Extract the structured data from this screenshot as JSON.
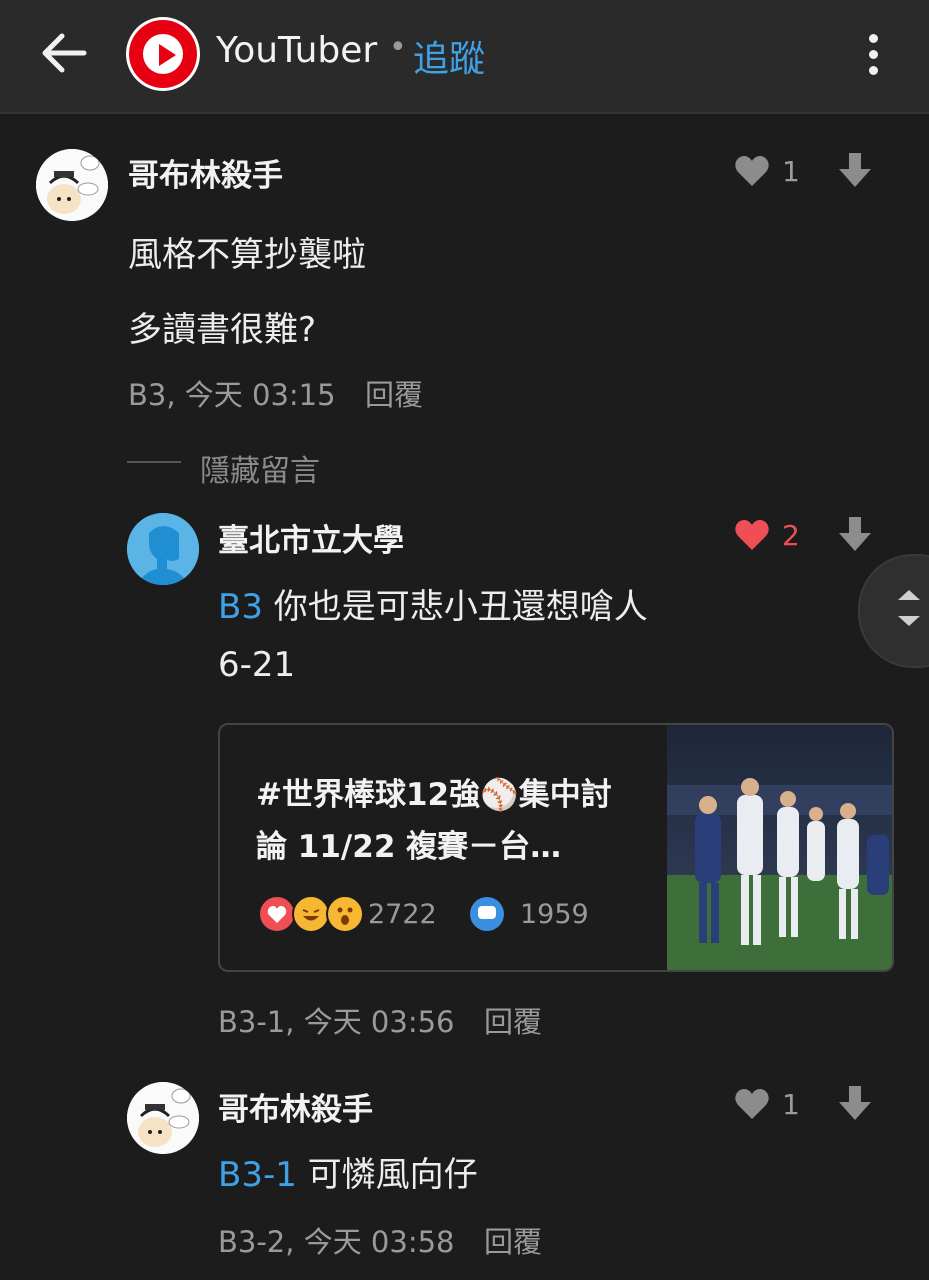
{
  "header": {
    "channel_name": "YouTuber",
    "separator": "•",
    "follow_label": "追蹤"
  },
  "comments": [
    {
      "username": "哥布林殺手",
      "lines": [
        "風格不算抄襲啦",
        "多讀書很難?"
      ],
      "like_count": "1",
      "floor": "B3, 今天 03:15",
      "reply_label": "回覆"
    },
    {
      "username": "臺北市立大學",
      "tag": "B3",
      "text": "你也是可悲小丑還想嗆人",
      "line2": "6-21",
      "like_count": "2",
      "liked": true,
      "floor": "B3-1, 今天 03:56",
      "reply_label": "回覆"
    },
    {
      "username": "哥布林殺手",
      "tag": "B3-1",
      "text": "可憐風向仔",
      "like_count": "1",
      "floor": "B3-2, 今天 03:58",
      "reply_label": "回覆"
    }
  ],
  "hide_comments_label": "隱藏留言",
  "link_card": {
    "title": "#世界棒球12強⚾集中討論 11/22 複賽－台…",
    "reaction_count": "2722",
    "comment_count": "1959"
  },
  "colors": {
    "background": "#1c1c1c",
    "topbar": "#2a2a2a",
    "accent_blue": "#3fa1e6",
    "like_red": "#ef4e55",
    "muted": "#9a9a9a"
  },
  "icons": [
    "back-arrow-icon",
    "youtube-logo-icon",
    "more-vert-icon",
    "heart-icon",
    "downvote-icon",
    "scroll-up-down-icon",
    "comment-bubble-icon"
  ]
}
